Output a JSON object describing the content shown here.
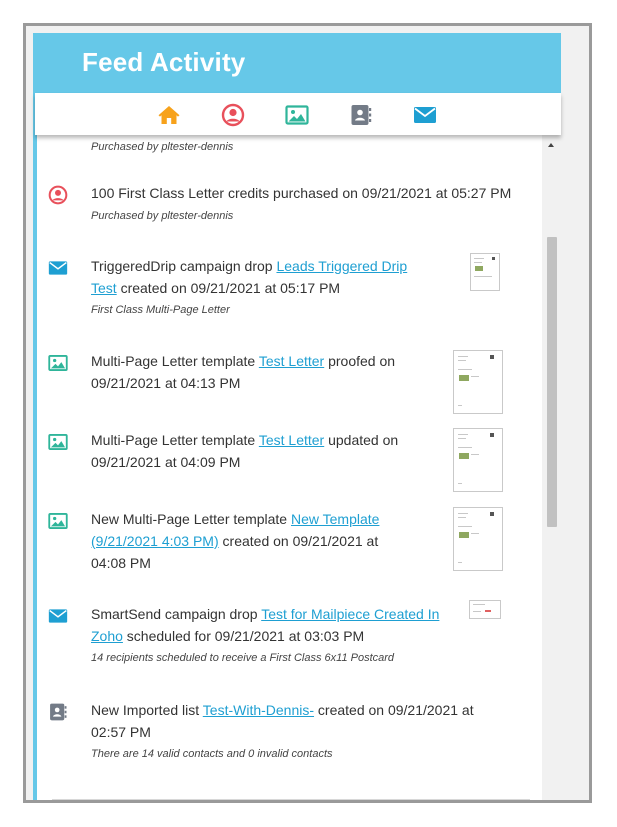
{
  "header": {
    "title": "Feed Activity"
  },
  "tabs": [
    {
      "name": "home-icon",
      "color": "#f7a21b"
    },
    {
      "name": "user-icon",
      "color": "#e8505b"
    },
    {
      "name": "image-icon",
      "color": "#2fb59a"
    },
    {
      "name": "contacts-icon",
      "color": "#737b87"
    },
    {
      "name": "mail-icon",
      "color": "#1e9fd2"
    }
  ],
  "feed": {
    "items": [
      {
        "sub": "Purchased by pltester-dennis"
      },
      {
        "icon": "user-icon",
        "text": "100 First Class Letter credits purchased on 09/21/2021 at 05:27 PM",
        "sub": "Purchased by pltester-dennis"
      },
      {
        "icon": "mail-icon",
        "pre": "TriggeredDrip campaign drop ",
        "link": "Leads Triggered Drip Test",
        "post": " created on 09/21/2021 at 05:17 PM",
        "sub": "First Class Multi-Page Letter"
      },
      {
        "icon": "image-icon",
        "pre": "Multi-Page Letter template ",
        "link": "Test Letter",
        "post": " proofed on 09/21/2021 at 04:13 PM"
      },
      {
        "icon": "image-icon",
        "pre": "Multi-Page Letter template ",
        "link": "Test Letter",
        "post": " updated on 09/21/2021 at 04:09 PM"
      },
      {
        "icon": "image-icon",
        "pre": "New Multi-Page Letter template ",
        "link": "New Template (9/21/2021 4:03 PM)",
        "post": " created on 09/21/2021 at 04:08 PM"
      },
      {
        "icon": "mail-icon",
        "pre": "SmartSend campaign drop ",
        "link": "Test for Mailpiece Created In Zoho",
        "post": " scheduled for 09/21/2021 at 03:03 PM",
        "sub": "14 recipients scheduled to receive a First Class 6x11 Postcard"
      },
      {
        "icon": "contacts-icon",
        "pre": "New Imported list ",
        "link": "Test-With-Dennis-",
        "post": " created on 09/21/2021 at 02:57 PM",
        "sub": "There are 14 valid contacts and 0 invalid contacts"
      }
    ]
  }
}
